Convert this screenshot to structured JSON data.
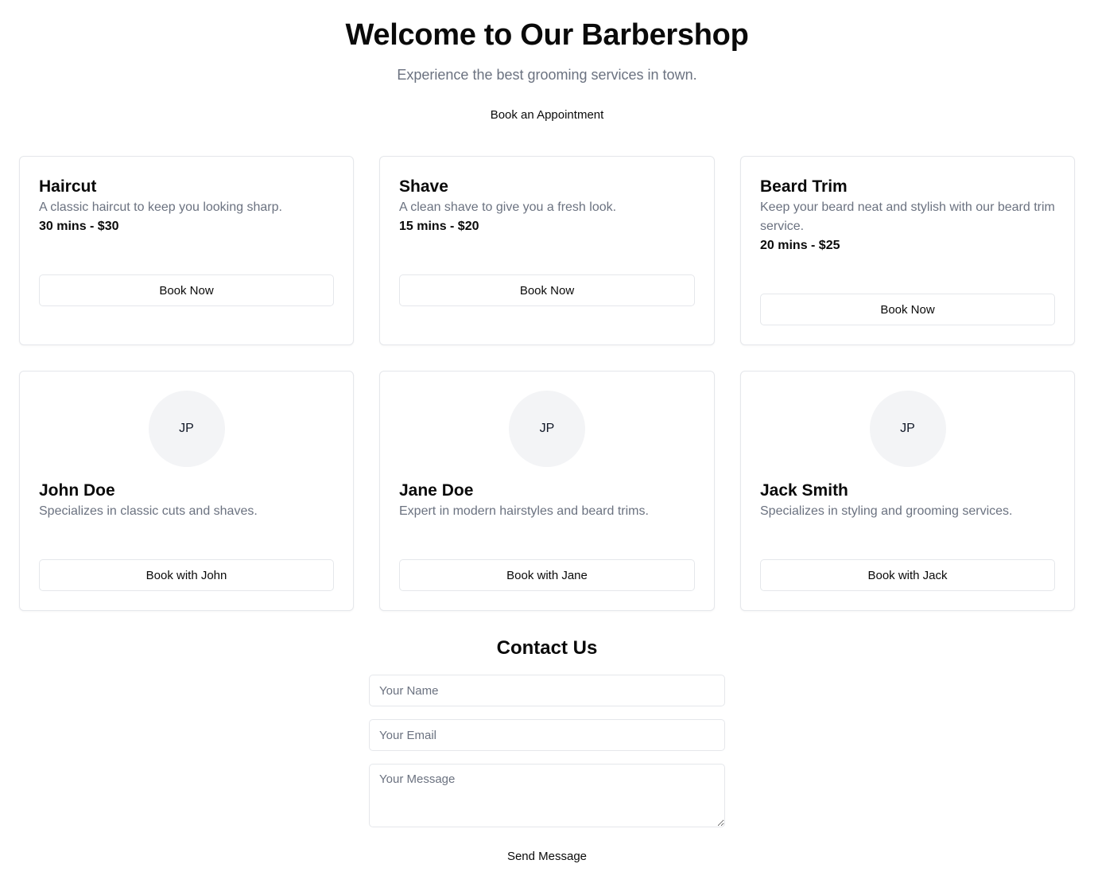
{
  "hero": {
    "title": "Welcome to Our Barbershop",
    "subtitle": "Experience the best grooming services in town.",
    "cta_label": "Book an Appointment"
  },
  "services": [
    {
      "name": "Haircut",
      "description": "A classic haircut to keep you looking sharp.",
      "details": "30 mins - $30",
      "button": "Book Now"
    },
    {
      "name": "Shave",
      "description": "A clean shave to give you a fresh look.",
      "details": "15 mins - $20",
      "button": "Book Now"
    },
    {
      "name": "Beard Trim",
      "description": "Keep your beard neat and stylish with our beard trim service.",
      "details": "20 mins - $25",
      "button": "Book Now"
    }
  ],
  "barbers": [
    {
      "initials": "JP",
      "name": "John Doe",
      "bio": "Specializes in classic cuts and shaves.",
      "button": "Book with John"
    },
    {
      "initials": "JP",
      "name": "Jane Doe",
      "bio": "Expert in modern hairstyles and beard trims.",
      "button": "Book with Jane"
    },
    {
      "initials": "JP",
      "name": "Jack Smith",
      "bio": "Specializes in styling and grooming services.",
      "button": "Book with Jack"
    }
  ],
  "contact": {
    "title": "Contact Us",
    "name_placeholder": "Your Name",
    "email_placeholder": "Your Email",
    "message_placeholder": "Your Message",
    "submit_label": "Send Message"
  }
}
